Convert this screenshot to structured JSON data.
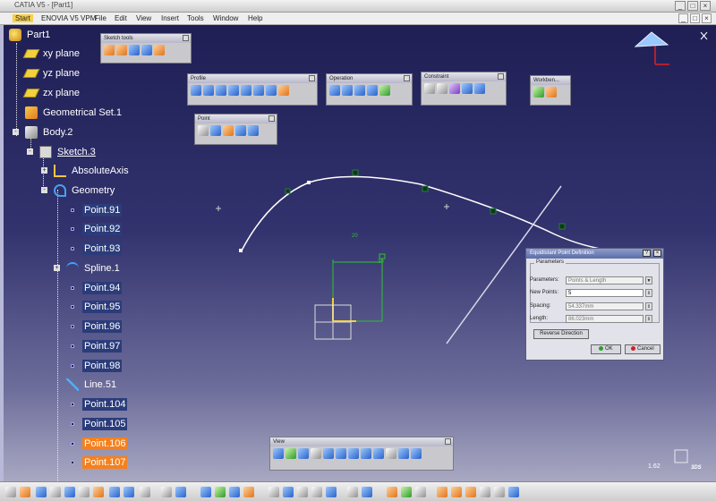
{
  "window": {
    "title": "CATIA V5 - [Part1]"
  },
  "menu": [
    "Start",
    "ENOVIA V5 VPM",
    "File",
    "Edit",
    "View",
    "Insert",
    "Tools",
    "Window",
    "Help"
  ],
  "tree": [
    {
      "label": "Part1",
      "icon": "part-icon"
    },
    {
      "label": "xy plane",
      "icon": "plane-icon"
    },
    {
      "label": "yz plane",
      "icon": "plane-icon"
    },
    {
      "label": "zx plane",
      "icon": "plane-icon"
    },
    {
      "label": "Geometrical Set.1",
      "icon": "geometrical-set-icon"
    },
    {
      "label": "Body.2",
      "icon": "body-icon"
    },
    {
      "label": "Sketch.3",
      "icon": "sketch-icon"
    },
    {
      "label": "AbsoluteAxis",
      "icon": "axis-icon"
    },
    {
      "label": "Geometry",
      "icon": "geometry-icon"
    },
    {
      "label": "Point.91",
      "icon": "point-icon"
    },
    {
      "label": "Point.92",
      "icon": "point-icon"
    },
    {
      "label": "Point.93",
      "icon": "point-icon"
    },
    {
      "label": "Spline.1",
      "icon": "spline-icon"
    },
    {
      "label": "Point.94",
      "icon": "point-icon"
    },
    {
      "label": "Point.95",
      "icon": "point-icon"
    },
    {
      "label": "Point.96",
      "icon": "point-icon"
    },
    {
      "label": "Point.97",
      "icon": "point-icon"
    },
    {
      "label": "Point.98",
      "icon": "point-icon"
    },
    {
      "label": "Line.51",
      "icon": "line-icon"
    },
    {
      "label": "Point.104",
      "icon": "point-icon"
    },
    {
      "label": "Point.105",
      "icon": "point-icon"
    },
    {
      "label": "Point.106",
      "icon": "point-icon"
    },
    {
      "label": "Point.107",
      "icon": "point-icon"
    }
  ],
  "toolbars": {
    "sketch_tools": "Sketch tools",
    "profile": "Profile",
    "operation": "Operation",
    "constraint": "Constraint",
    "workbench": "Workben...",
    "point": "Point",
    "view": "View"
  },
  "dialog": {
    "title": "Equidistant Point Definition",
    "group": "Parameters",
    "parameters_label": "Parameters:",
    "parameters_value": "Points & Length",
    "new_points_label": "New Points:",
    "new_points_value": "5",
    "spacing_label": "Spacing:",
    "spacing_value": "54.337mm",
    "length_label": "Length:",
    "length_value": "86.023mm",
    "reverse_label": "Reverse Direction",
    "ok_label": "OK",
    "cancel_label": "Cancel"
  },
  "dimensions": {
    "h": "20",
    "v": "30"
  },
  "status": {
    "zoom": "1.62"
  },
  "colors": {
    "background_top": "#1f1f55",
    "background_bottom": "#a8a8c2",
    "selection": "#f5811e",
    "highlight": "#2b3c7a"
  }
}
